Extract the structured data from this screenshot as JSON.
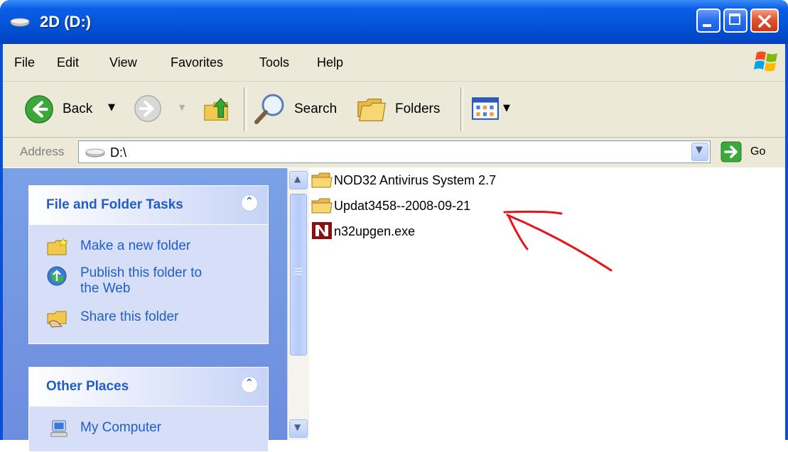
{
  "window": {
    "title": "2D (D:)",
    "buttons": [
      "minimize",
      "maximize",
      "close"
    ]
  },
  "menu": {
    "items": [
      "File",
      "Edit",
      "View",
      "Favorites",
      "Tools",
      "Help"
    ]
  },
  "toolbar": {
    "back_label": "Back",
    "search_label": "Search",
    "folders_label": "Folders"
  },
  "address": {
    "label": "Address",
    "value": "D:\\",
    "go_label": "Go"
  },
  "tasks_panel": {
    "title": "File and Folder Tasks",
    "items": [
      {
        "label": "Make a new folder",
        "icon": "new-folder-icon"
      },
      {
        "label_line1": "Publish this folder to",
        "label_line2": "the Web",
        "icon": "publish-web-icon"
      },
      {
        "label": "Share this folder",
        "icon": "share-folder-icon"
      }
    ]
  },
  "places_panel": {
    "title": "Other Places",
    "items": [
      {
        "label": "My Computer",
        "icon": "my-computer-icon"
      }
    ]
  },
  "files": [
    {
      "name": "NOD32 Antivirus System 2.7",
      "icon": "folder-icon"
    },
    {
      "name": "Updat3458--2008-09-21",
      "icon": "folder-icon"
    },
    {
      "name": "n32upgen.exe",
      "icon": "nod32-exe-icon"
    }
  ],
  "colors": {
    "titlebar": "#0554d9",
    "task_link": "#215dc6",
    "annotation_arrow": "#e8141c"
  }
}
